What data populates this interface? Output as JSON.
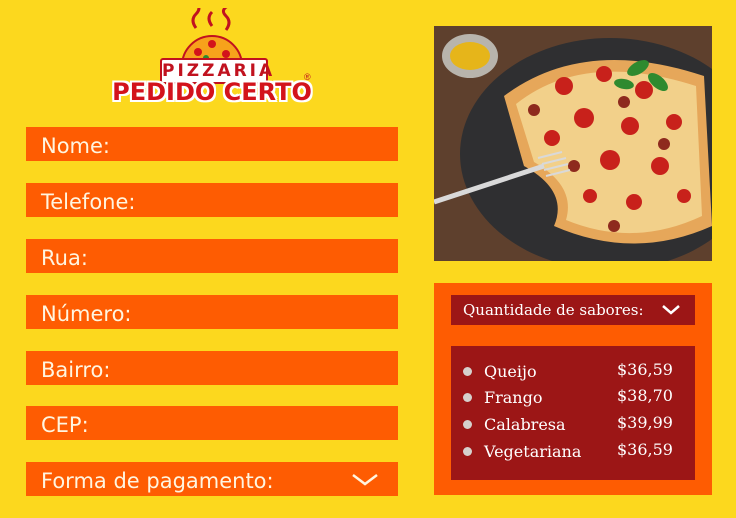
{
  "logo": {
    "top": "PIZZARIA",
    "main": "PEDIDO CERTO",
    "reg": "®"
  },
  "form": {
    "fields": [
      {
        "label": "Nome:"
      },
      {
        "label": "Telefone:"
      },
      {
        "label": "Rua:"
      },
      {
        "label": "Número:"
      },
      {
        "label": "Bairro:"
      },
      {
        "label": "CEP:"
      },
      {
        "label": "Forma de pagamento:"
      }
    ]
  },
  "flavors": {
    "select_label": "Quantidade de sabores:",
    "items": [
      {
        "name": "Queijo",
        "price": "$36,59"
      },
      {
        "name": "Frango",
        "price": "$38,70"
      },
      {
        "name": "Calabresa",
        "price": "$39,99"
      },
      {
        "name": "Vegetariana",
        "price": "$36,59"
      }
    ]
  },
  "colors": {
    "background": "#fcd81e",
    "orange": "#fe5c02",
    "dark_red": "#9c1616"
  }
}
